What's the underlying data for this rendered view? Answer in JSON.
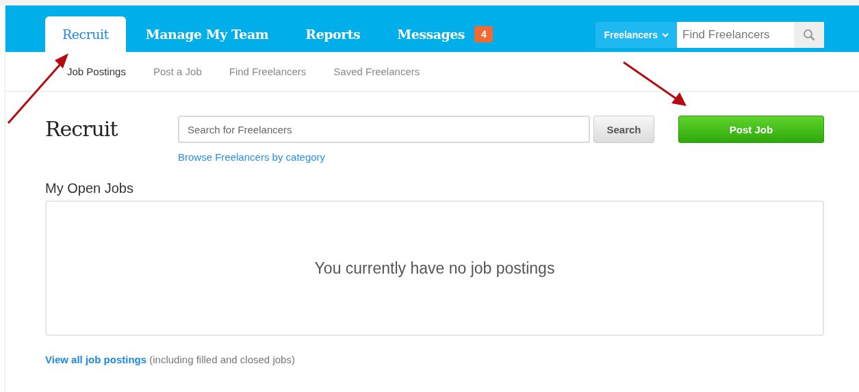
{
  "tabs": [
    {
      "label": "Recruit",
      "selected": true
    },
    {
      "label": "Manage My Team",
      "selected": false
    },
    {
      "label": "Reports",
      "selected": false
    },
    {
      "label": "Messages",
      "selected": false,
      "badge": "4"
    }
  ],
  "header_search": {
    "scope": "Freelancers",
    "placeholder": "Find Freelancers"
  },
  "subnav": [
    {
      "label": "Job Postings",
      "selected": true
    },
    {
      "label": "Post a Job",
      "selected": false
    },
    {
      "label": "Find Freelancers",
      "selected": false
    },
    {
      "label": "Saved Freelancers",
      "selected": false
    }
  ],
  "page_title": "Recruit",
  "search": {
    "placeholder": "Search for Freelancers",
    "button": "Search",
    "link": "Browse Freelancers by category"
  },
  "post_button": "Post Job",
  "section_title": "My Open Jobs",
  "empty_message": "You currently have no job postings",
  "footer": {
    "link": "View all job postings",
    "note": "(including filled and closed jobs)"
  }
}
